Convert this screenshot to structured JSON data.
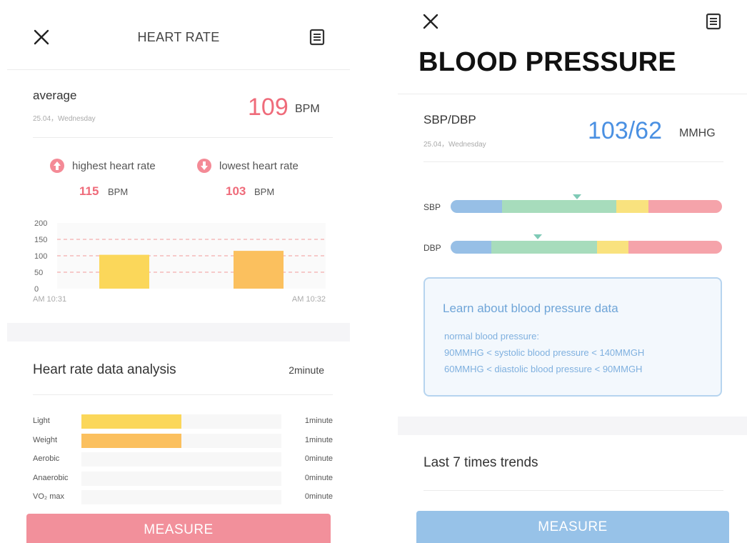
{
  "heart_rate": {
    "title": "HEART RATE",
    "summary": {
      "label": "average",
      "date": "25.04，Wednesday",
      "value": "109",
      "unit": "BPM"
    },
    "highest": {
      "label": "highest heart rate",
      "value": "115",
      "unit": "BPM"
    },
    "lowest": {
      "label": "lowest heart rate",
      "value": "103",
      "unit": "BPM"
    },
    "chart_data": {
      "type": "bar",
      "categories": [
        "",
        ""
      ],
      "values": [
        103,
        115
      ],
      "colors": [
        "#fbd75a",
        "#fbc05e"
      ],
      "y_ticks": [
        "200",
        "150",
        "100",
        "50",
        "0"
      ],
      "ylim": [
        0,
        200
      ],
      "x_start_label": "AM 10:31",
      "x_end_label": "AM 10:32",
      "dashed_reference_lines": [
        50,
        100,
        150
      ],
      "reference_line_color": "#f39a9a"
    },
    "analysis": {
      "title": "Heart rate data analysis",
      "total": "2minute",
      "zones": [
        {
          "label": "Light",
          "duration": "1minute",
          "fraction": 0.5,
          "color": "#fbd75a"
        },
        {
          "label": "Weight",
          "duration": "1minute",
          "fraction": 0.5,
          "color": "#fbc05e"
        },
        {
          "label": "Aerobic",
          "duration": "0minute",
          "fraction": 0,
          "color": "#f7a76a"
        },
        {
          "label": "Anaerobic",
          "duration": "0minute",
          "fraction": 0,
          "color": "#f48a96"
        },
        {
          "label": "VO₂ max",
          "duration": "0minute",
          "fraction": 0,
          "color": "#ef6b7a"
        }
      ]
    },
    "measure_label": "MEASURE",
    "accent_color": "#ef6b7a",
    "close_icon": "close-icon",
    "record_icon": "document-icon"
  },
  "blood_pressure": {
    "title": "BLOOD PRESSURE",
    "summary": {
      "label": "SBP/DBP",
      "date": "25.04，Wednesday",
      "value": "103/62",
      "unit": "MMHG"
    },
    "sbp_bar": {
      "label": "SBP",
      "segments": [
        {
          "fraction": 0.19,
          "color": "#97bfe6"
        },
        {
          "fraction": 0.42,
          "color": "#a7dcbc"
        },
        {
          "fraction": 0.12,
          "color": "#f9e27e"
        },
        {
          "fraction": 0.27,
          "color": "#f5a3aa"
        }
      ],
      "marker_fraction": 0.465
    },
    "dbp_bar": {
      "label": "DBP",
      "segments": [
        {
          "fraction": 0.15,
          "color": "#97bfe6"
        },
        {
          "fraction": 0.39,
          "color": "#a7dcbc"
        },
        {
          "fraction": 0.115,
          "color": "#f9e27e"
        },
        {
          "fraction": 0.345,
          "color": "#f5a3aa"
        }
      ],
      "marker_fraction": 0.32
    },
    "info": {
      "title": "Learn about blood pressure data",
      "line1": "normal blood pressure:",
      "line2": "90MMHG < systolic blood pressure < 140MMGH",
      "line3": "60MMHG < diastolic blood pressure < 90MMGH"
    },
    "trends_label": "Last 7 times trends",
    "measure_label": "MEASURE",
    "accent_color": "#4a90e2",
    "close_icon": "close-icon",
    "record_icon": "document-icon"
  }
}
